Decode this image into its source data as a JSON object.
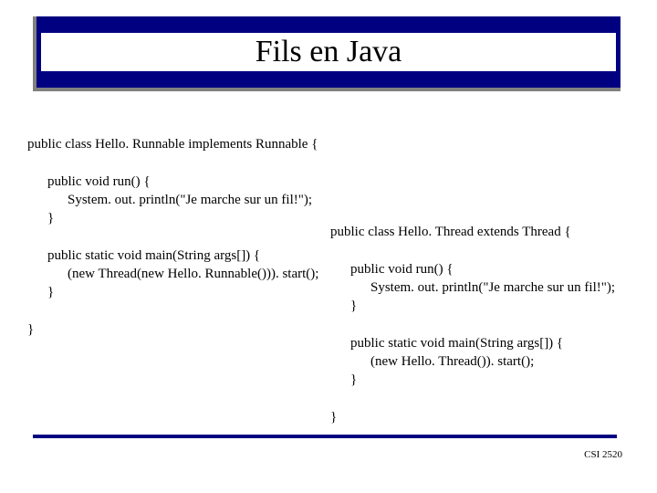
{
  "title": "Fils en Java",
  "code_left": {
    "l1": "public class Hello. Runnable implements Runnable {",
    "l2": "public void run() {",
    "l3": "System. out. println(\"Je marche sur un fil!\");",
    "l4": "}",
    "l5": "public static void main(String args[]) {",
    "l6": "(new Thread(new Hello. Runnable())). start();",
    "l7": "}",
    "l8": "}"
  },
  "code_right": {
    "r1": "public class Hello. Thread extends Thread {",
    "r2": "public void run() {",
    "r3": "System. out. println(\"Je marche sur un fil!\");",
    "r4": "}",
    "r5": "public static void main(String args[]) {",
    "r6": "(new Hello. Thread()). start();",
    "r7": "}",
    "r8": "}"
  },
  "footer": "CSI 2520"
}
